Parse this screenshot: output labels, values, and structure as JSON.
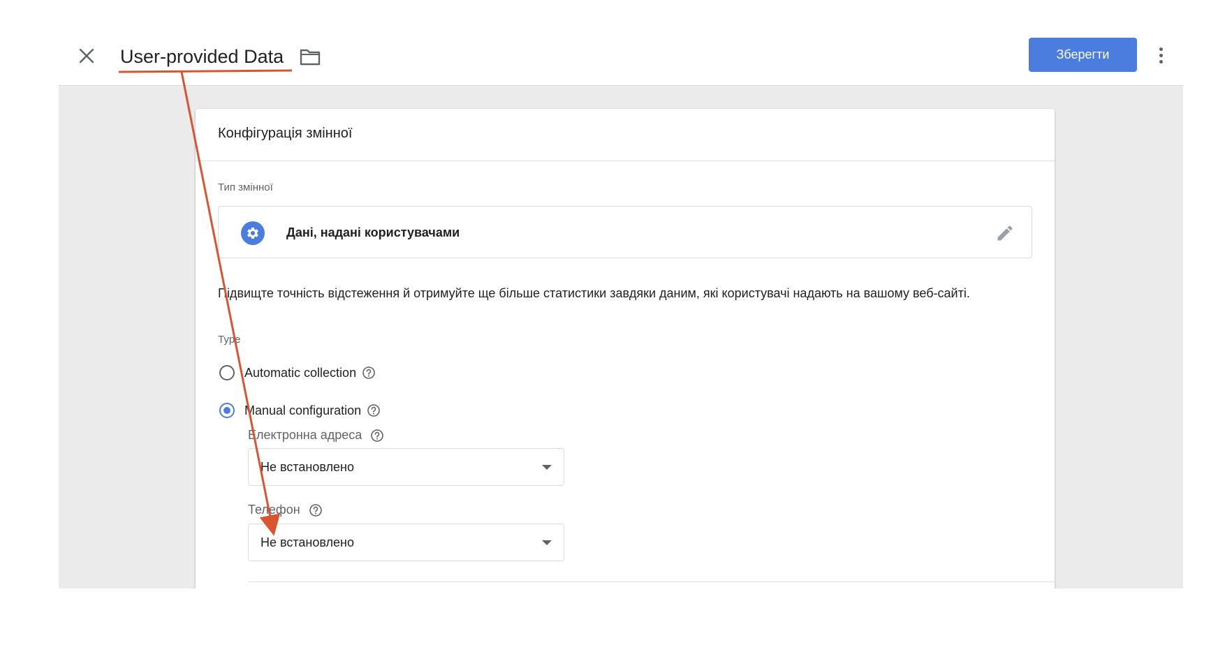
{
  "header": {
    "title": "User-provided Data",
    "save_label": "Зберегти",
    "accent_color": "#4a7ddd"
  },
  "card": {
    "title": "Конфігурація змінної",
    "variable_type_label": "Тип змінної",
    "variable_type_name": "Дані, надані користувачами",
    "description": "Підвищте точність відстеження й отримуйте ще більше статистики завдяки даним, які користувачі надають на вашому веб-сайті.",
    "type_label": "Type",
    "options": [
      {
        "label": "Automatic collection",
        "checked": false
      },
      {
        "label": "Manual configuration",
        "checked": true
      }
    ],
    "fields": [
      {
        "label": "Електронна адреса",
        "value": "Не встановлено"
      },
      {
        "label": "Телефон",
        "value": "Не встановлено"
      }
    ]
  },
  "annotation": {
    "color": "#d9542f",
    "description": "red underline on title with arrow pointing to the phone dropdown"
  }
}
